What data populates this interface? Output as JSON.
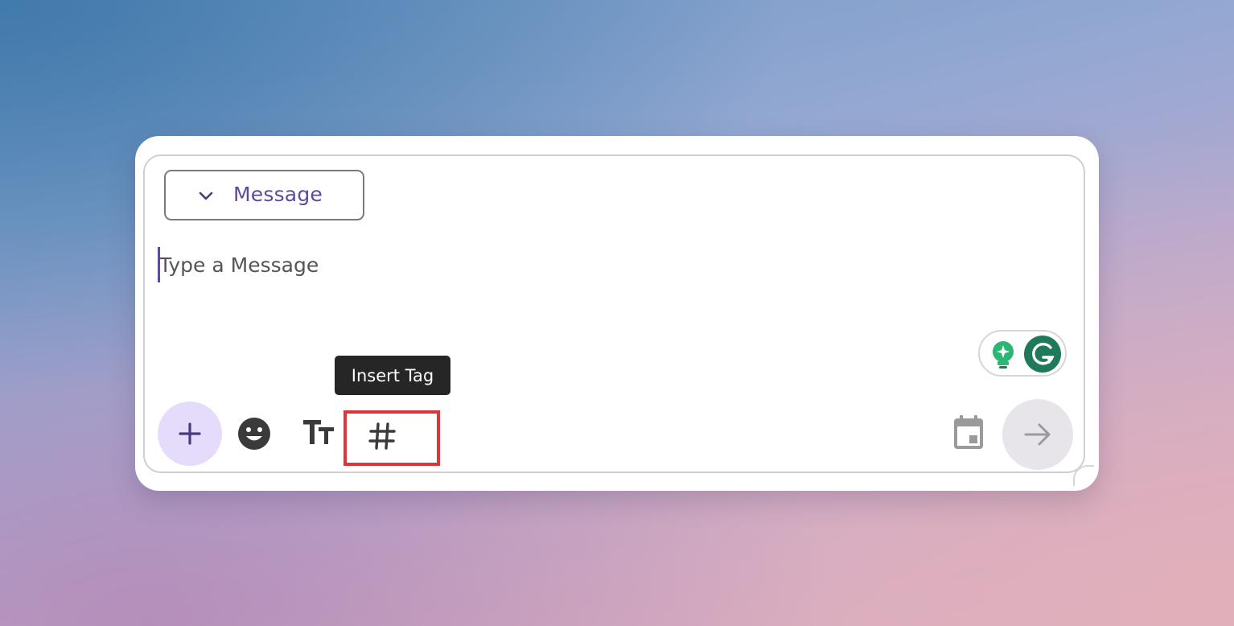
{
  "composer": {
    "type_selector": {
      "label": "Message"
    },
    "input": {
      "placeholder": "Type a Message",
      "value": ""
    },
    "tooltip": {
      "text": "Insert Tag"
    },
    "toolbar": {
      "left_icons": [
        "plus-icon",
        "emoji-icon",
        "text-format-icon",
        "hashtag-icon"
      ],
      "right_icons": [
        "calendar-icon",
        "arrow-right-icon"
      ]
    },
    "grammarly": {
      "icons": [
        "lightbulb-icon",
        "grammarly-g-icon"
      ]
    }
  },
  "colors": {
    "accent": "#5e4a9c",
    "add_button_bg": "#e4dcfa",
    "highlight_box": "#e0343c",
    "tooltip_bg": "#262626",
    "grammarly_green": "#1f7a5c",
    "grammarly_bulb": "#2bb673"
  }
}
